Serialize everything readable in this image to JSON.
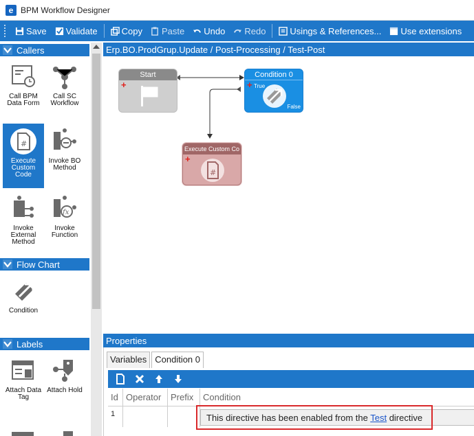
{
  "window": {
    "title": "BPM Workflow Designer"
  },
  "toolbar": {
    "save": "Save",
    "validate": "Validate",
    "copy": "Copy",
    "paste": "Paste",
    "undo": "Undo",
    "redo": "Redo",
    "usings": "Usings & References...",
    "extensions": "Use extensions"
  },
  "palette": {
    "callers": {
      "title": "Callers",
      "items": [
        {
          "label": "Call BPM Data Form",
          "icon": "form-icon"
        },
        {
          "label": "Call SC Workflow",
          "icon": "workflow-icon"
        },
        {
          "label": "Execute Custom Code",
          "icon": "code-file-icon",
          "selected": true
        },
        {
          "label": "Invoke BO Method",
          "icon": "bo-method-icon"
        },
        {
          "label": "Invoke External Method",
          "icon": "external-method-icon"
        },
        {
          "label": "Invoke Function",
          "icon": "function-icon"
        }
      ]
    },
    "flowchart": {
      "title": "Flow Chart",
      "items": [
        {
          "label": "Condition",
          "icon": "condition-icon"
        }
      ]
    },
    "labels": {
      "title": "Labels",
      "items": [
        {
          "label": "Attach Data Tag",
          "icon": "data-tag-icon"
        },
        {
          "label": "Attach Hold",
          "icon": "hold-icon"
        }
      ]
    }
  },
  "canvas": {
    "breadcrumb": "Erp.BO.ProdGrup.Update / Post-Processing / Test-Post",
    "nodes": {
      "start": "Start",
      "condition": "Condition 0",
      "condition_true": "True",
      "condition_false": "False",
      "exec": "Execute Custom Co"
    }
  },
  "properties": {
    "title": "Properties",
    "tabs": [
      "Variables",
      "Condition 0"
    ],
    "columns": [
      "Id",
      "Operator",
      "Prefix",
      "Condition"
    ],
    "row": {
      "id": "1",
      "text_before": "This directive has been enabled from the ",
      "link": "Test",
      "text_after": " directive"
    }
  }
}
